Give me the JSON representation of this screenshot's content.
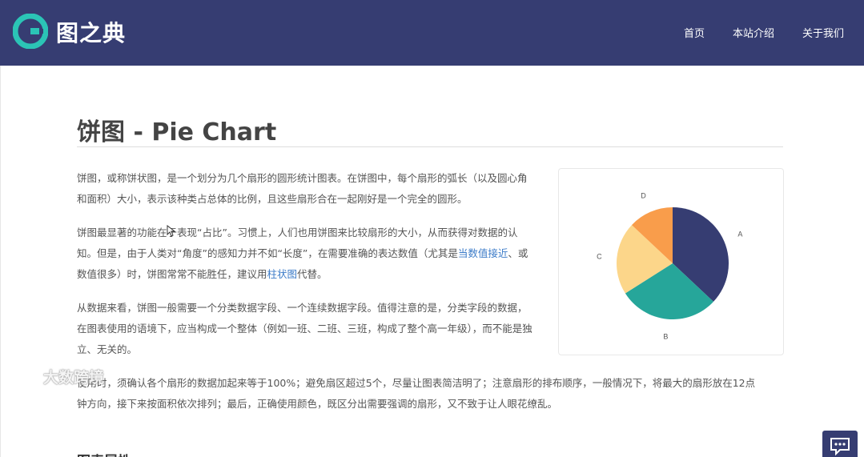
{
  "header": {
    "brand": "图之典",
    "nav": [
      "首页",
      "本站介绍",
      "关于我们"
    ]
  },
  "main": {
    "title": "饼图 - Pie Chart",
    "p1": "饼图，或称饼状图，是一个划分为几个扇形的圆形统计图表。在饼图中，每个扇形的弧长（以及圆心角和面积）大小，表示该种类占总体的比例，且这些扇形合在一起刚好是一个完全的圆形。",
    "p2_a": "饼图最显著的功能在于表现“占比”。习惯上，人们也用饼图来比较扇形的大小，从而获得对数据的认知。但是，由于人类对“角度”的感知力并不如“长度”，在需要准确的表达数值（尤其是",
    "p2_link1": "当数值接近",
    "p2_b": "、或数值很多）时，饼图常常不能胜任，建议用",
    "p2_link2": "柱状图",
    "p2_c": "代替。",
    "p3": "从数据来看，饼图一般需要一个分类数据字段、一个连续数据字段。值得注意的是，分类字段的数据，在图表使用的语境下，应当构成一个整体（例如一班、二班、三班，构成了整个高一年级），而不能是独立、无关的。",
    "p4": "使用时，须确认各个扇形的数据加起来等于100%；避免扇区超过5个，尽量让图表简洁明了；注意扇形的排布顺序，一般情况下，将最大的扇形放在12点钟方向，接下来按面积依次排列；最后，正确使用颜色，既区分出需要强调的扇形，又不致于让人眼花缭乱。",
    "next_heading": "图表属性"
  },
  "watermark": "大数跨境",
  "chart_data": {
    "type": "pie",
    "categories": [
      "A",
      "B",
      "C",
      "D"
    ],
    "values": [
      37,
      29,
      21,
      13
    ],
    "colors": [
      "#363d72",
      "#26a69a",
      "#fcd68a",
      "#f99d4b"
    ],
    "start": "12 o'clock",
    "direction": "clockwise"
  }
}
